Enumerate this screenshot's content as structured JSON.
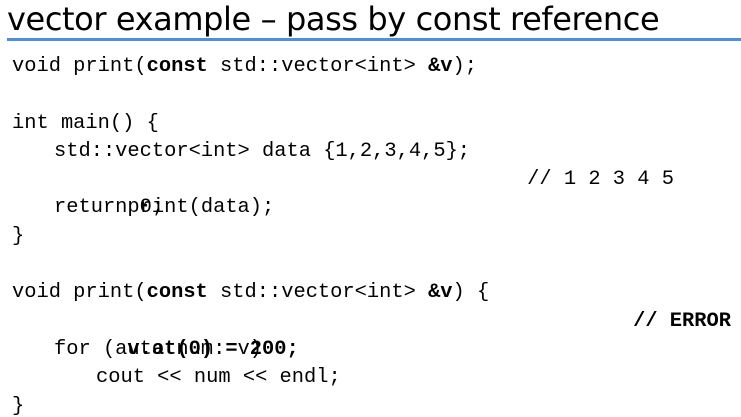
{
  "slide": {
    "title": "vector example – pass by const reference",
    "accent_color": "#4a90e2"
  },
  "code": {
    "decl": {
      "part1": "void print(",
      "kw": "const",
      "part2": " std::vector<int> ",
      "ref": "&v",
      "part3": ");"
    },
    "main_sig": "int main() {",
    "vec_decl": "std::vector<int> data {1,2,3,4,5};",
    "print_call": "print(data);",
    "print_comment": "// 1 2 3 4 5",
    "return_stmt": "return 0;",
    "close_brace_main": "}",
    "def": {
      "part1": "void print(",
      "kw": "const",
      "part2": " std::vector<int> ",
      "ref": "&v",
      "part3": ") {"
    },
    "assign_stmt": "v.at(0) = 200;",
    "error_comment": "// ERROR",
    "for_stmt": "for (auto num: v)",
    "cout_stmt": "cout << num << endl;",
    "close_brace_def": "}"
  }
}
